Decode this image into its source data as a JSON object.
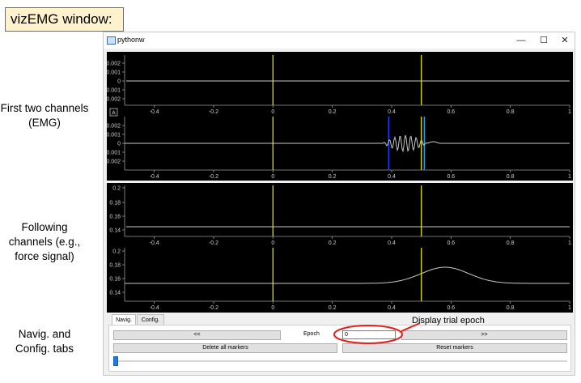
{
  "header_label": "vizEMG window:",
  "side_labels": {
    "emg": "First two channels (EMG)",
    "force": "Following channels (e.g., force signal)",
    "tabs": "Navig. and Config. tabs"
  },
  "annotation": "Display trial epoch",
  "window": {
    "title": "pythonw",
    "minimize": "—",
    "maximize": "☐",
    "close": "✕"
  },
  "plots": {
    "x_ticks": [
      "-0.4",
      "-0.2",
      "0",
      "0.2",
      "0.4",
      "0.6",
      "0.8",
      "1"
    ],
    "emg_y_ticks": [
      "0.002",
      "0.001",
      "0",
      "-0.001",
      "-0.002"
    ],
    "force_y_ticks": [
      "0.2",
      "0.18",
      "0.16",
      "0.14"
    ],
    "autoscale_label": "A",
    "trace_color": "#c8c8c8",
    "marker_color": "#d4d400",
    "onset_color": "#1f3cff",
    "offset_color": "#1fa2e0"
  },
  "tabs": {
    "navig": "Navig.",
    "config": "Config."
  },
  "nav": {
    "prev_button": "<<",
    "epoch_label": "Epoch",
    "epoch_value": "0",
    "next_button": ">>",
    "delete_markers": "Delete all markers",
    "reset_markers": "Reset markers",
    "slider_value": 0
  }
}
